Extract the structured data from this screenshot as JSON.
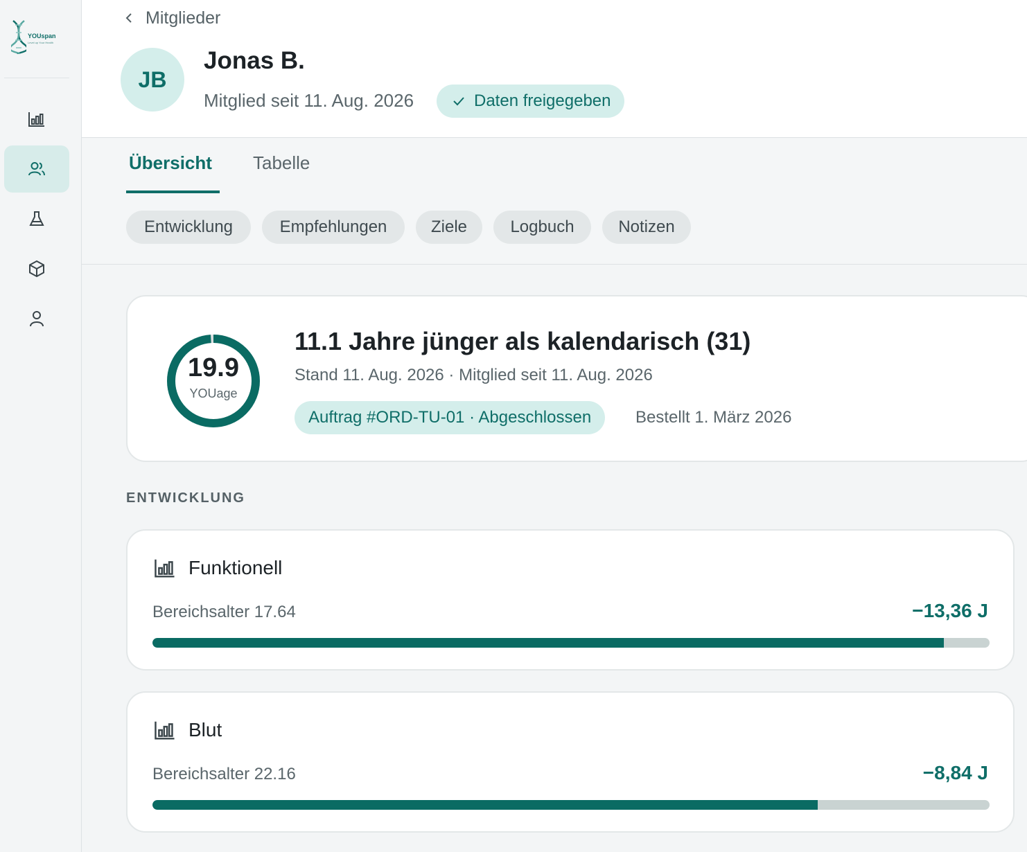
{
  "logo": {
    "brand": "YOUspan",
    "tagline": "Level up Your Health"
  },
  "sidebar": {
    "items": [
      {
        "name": "analytics",
        "icon": "bar-chart-icon",
        "active": false
      },
      {
        "name": "members",
        "icon": "users-icon",
        "active": true
      },
      {
        "name": "lab",
        "icon": "flask-icon",
        "active": false
      },
      {
        "name": "products",
        "icon": "box-icon",
        "active": false
      },
      {
        "name": "profile",
        "icon": "user-icon",
        "active": false
      }
    ]
  },
  "header": {
    "back_label": "Mitglieder",
    "initials": "JB",
    "name": "Jonas B.",
    "member_since": "Mitglied seit 11. Aug. 2026",
    "shared_badge": "Daten freigegeben"
  },
  "tabs": [
    {
      "label": "Übersicht",
      "active": true
    },
    {
      "label": "Tabelle",
      "active": false
    }
  ],
  "chips": [
    "Entwicklung",
    "Empfehlungen",
    "Ziele",
    "Logbuch",
    "Notizen"
  ],
  "age_card": {
    "value": "19.9",
    "value_label": "YOUage",
    "ring_progress": 0.99,
    "headline": "11.1 Jahre jünger als kalendarisch (31)",
    "subline": "Stand 11. Aug. 2026 · Mitglied seit 11. Aug. 2026",
    "order_pill": "Auftrag #ORD-TU-01 · Abgeschlossen",
    "order_date": "Bestellt 1. März 2026"
  },
  "section_title": "ENTWICKLUNG",
  "metrics": [
    {
      "title": "Funktionell",
      "sub": "Bereichsalter 17.64",
      "delta": "−13,36 J",
      "fill": 0.945
    },
    {
      "title": "Blut",
      "sub": "Bereichsalter 22.16",
      "delta": "−8,84 J",
      "fill": 0.795
    }
  ],
  "colors": {
    "accent": "#0f6e68",
    "accent_soft": "#d4eeeb",
    "bar_fill": "#0a6b63",
    "bar_track": "#c9d3d2"
  }
}
